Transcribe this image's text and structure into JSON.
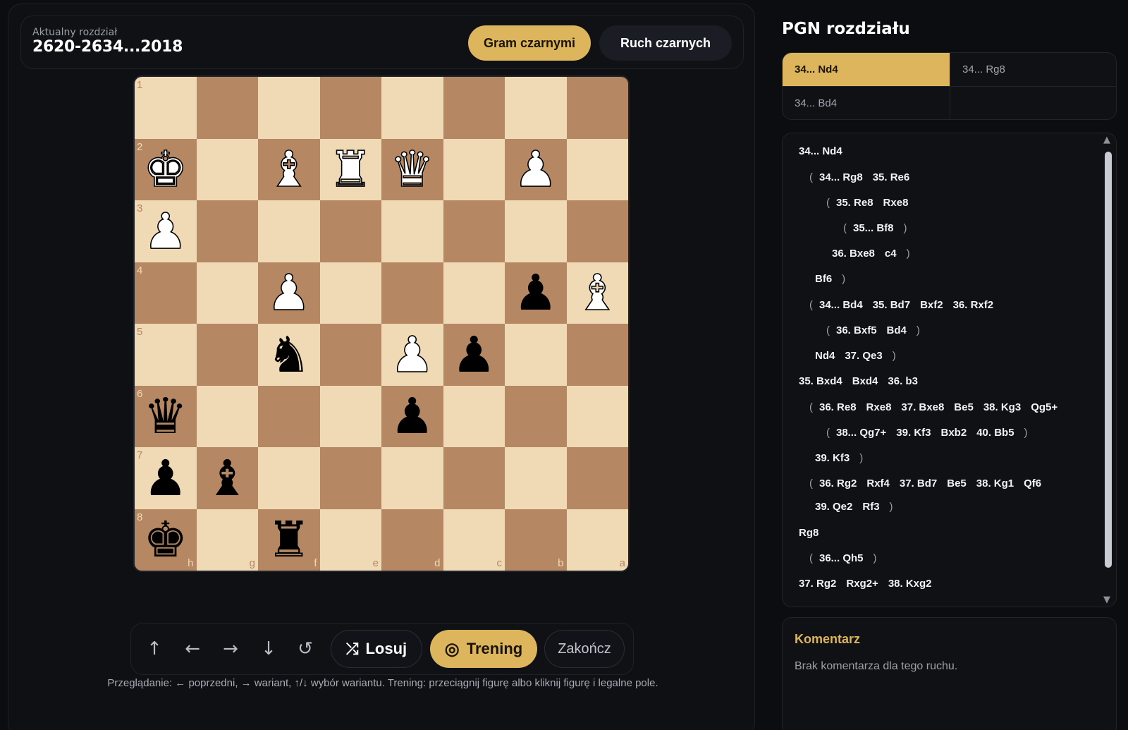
{
  "header": {
    "chapter_label": "Aktualny rozdział",
    "chapter_title": "2620-2634...2018",
    "play_as_label": "Gram czarnymi",
    "to_move_label": "Ruch czarnych"
  },
  "board": {
    "ranks": [
      "1",
      "2",
      "3",
      "4",
      "5",
      "6",
      "7",
      "8"
    ],
    "files": [
      "h",
      "g",
      "f",
      "e",
      "d",
      "c",
      "b",
      "a"
    ],
    "pieces": [
      "........",
      "K.BRQ.P.",
      "P.......",
      "..P...pB",
      "..n.Pp..",
      "q...p...",
      "pb......",
      "k.r....."
    ],
    "glyphs": {
      "K": "♚",
      "Q": "♛",
      "R": "♜",
      "B": "♝",
      "N": "♞",
      "P": "♟",
      "k": "♚",
      "q": "♛",
      "r": "♜",
      "b": "♝",
      "n": "♞",
      "p": "♟"
    },
    "colors": {
      "light": "#f0d9b5",
      "dark": "#b58863"
    }
  },
  "controls": {
    "icons": [
      "arrow-up-icon",
      "arrow-left-icon",
      "arrow-right-icon",
      "arrow-down-icon",
      "reset-icon"
    ],
    "random_label": "Losuj",
    "training_label": "Trening",
    "finish_label": "Zakończ",
    "hint": "Przeglądanie: ← poprzedni, → wariant, ↑/↓ wybór wariantu. Trening: przeciągnij figurę albo kliknij figurę i legalne pole."
  },
  "pgn": {
    "title": "PGN rozdziału",
    "variants": [
      "34... Nd4",
      "34... Rg8",
      "34... Bd4"
    ],
    "lines": [
      {
        "indent": 0,
        "moves": [
          "34... Nd4"
        ]
      },
      {
        "indent": 1,
        "open": true,
        "moves": [
          "34... Rg8",
          "35. Re6"
        ]
      },
      {
        "indent": 2,
        "open": true,
        "moves": [
          "35. Re8",
          "Rxe8"
        ]
      },
      {
        "indent": 3,
        "open": true,
        "close": true,
        "moves": [
          "35... Bf8"
        ]
      },
      {
        "indent": 2,
        "close": true,
        "moves": [
          "36. Bxe8",
          "c4"
        ]
      },
      {
        "indent": 1,
        "close": true,
        "moves": [
          "Bf6"
        ]
      },
      {
        "indent": 1,
        "open": true,
        "moves": [
          "34... Bd4",
          "35. Bd7",
          "Bxf2",
          "36. Rxf2"
        ]
      },
      {
        "indent": 2,
        "open": true,
        "close": true,
        "moves": [
          "36. Bxf5",
          "Bd4"
        ]
      },
      {
        "indent": 1,
        "close": true,
        "moves": [
          "Nd4",
          "37. Qe3"
        ]
      },
      {
        "indent": 0,
        "moves": [
          "35. Bxd4",
          "Bxd4",
          "36. b3"
        ]
      },
      {
        "indent": 1,
        "open": true,
        "moves": [
          "36. Re8",
          "Rxe8",
          "37. Bxe8",
          "Be5",
          "38. Kg3",
          "Qg5+"
        ]
      },
      {
        "indent": 2,
        "open": true,
        "close": true,
        "moves": [
          "38... Qg7+",
          "39. Kf3",
          "Bxb2",
          "40. Bb5"
        ]
      },
      {
        "indent": 1,
        "close": true,
        "moves": [
          "39. Kf3"
        ]
      },
      {
        "indent": 1,
        "open": true,
        "moves": [
          "36. Rg2",
          "Rxf4",
          "37. Bd7",
          "Be5",
          "38. Kg1",
          "Qf6"
        ]
      },
      {
        "indent": 1,
        "close": true,
        "moves": [
          "39. Qe2",
          "Rf3"
        ]
      },
      {
        "indent": 0,
        "moves": [
          "Rg8"
        ]
      },
      {
        "indent": 1,
        "open": true,
        "close": true,
        "moves": [
          "36... Qh5"
        ]
      },
      {
        "indent": 0,
        "moves": [
          "37. Rg2",
          "Rxg2+",
          "38. Kxg2"
        ]
      }
    ]
  },
  "comment": {
    "title": "Komentarz",
    "text": "Brak komentarza dla tego ruchu."
  }
}
